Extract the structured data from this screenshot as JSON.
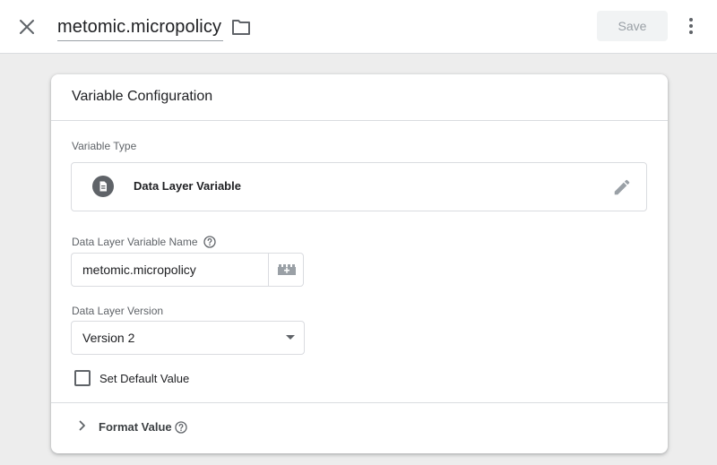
{
  "header": {
    "title": "metomic.micropolicy",
    "save_label": "Save"
  },
  "card": {
    "title": "Variable Configuration",
    "variable_type": {
      "label": "Variable Type",
      "name": "Data Layer Variable",
      "icon": "document-icon"
    },
    "dl_name": {
      "label": "Data Layer Variable Name",
      "value": "metomic.micropolicy"
    },
    "dl_version": {
      "label": "Data Layer Version",
      "value": "Version 2"
    },
    "default_value": {
      "label": "Set Default Value",
      "checked": false
    },
    "format_value": {
      "label": "Format Value"
    }
  },
  "colors": {
    "background": "#ededed",
    "surface": "#ffffff",
    "border": "#dadce0",
    "text": "#202124",
    "muted": "#5f6368",
    "icon": "#5f6368"
  }
}
